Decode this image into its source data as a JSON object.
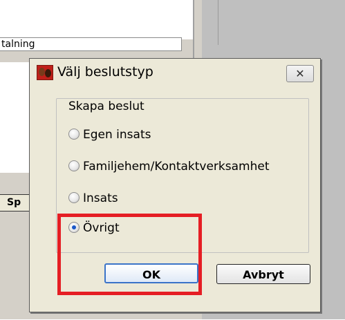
{
  "background": {
    "text_field_value": "talning",
    "partial_button_label": "Sp"
  },
  "dialog": {
    "title": "Välj beslutstyp",
    "close_glyph": "✕",
    "group_label": "Skapa beslut",
    "options": [
      {
        "label": "Egen insats",
        "selected": false
      },
      {
        "label": "Familjehem/Kontaktverksamhet",
        "selected": false
      },
      {
        "label": "Insats",
        "selected": false
      },
      {
        "label": "Övrigt",
        "selected": true
      }
    ],
    "ok_label": "OK",
    "cancel_label": "Avbryt"
  },
  "annotation": {
    "highlight_color": "#e51e24"
  }
}
